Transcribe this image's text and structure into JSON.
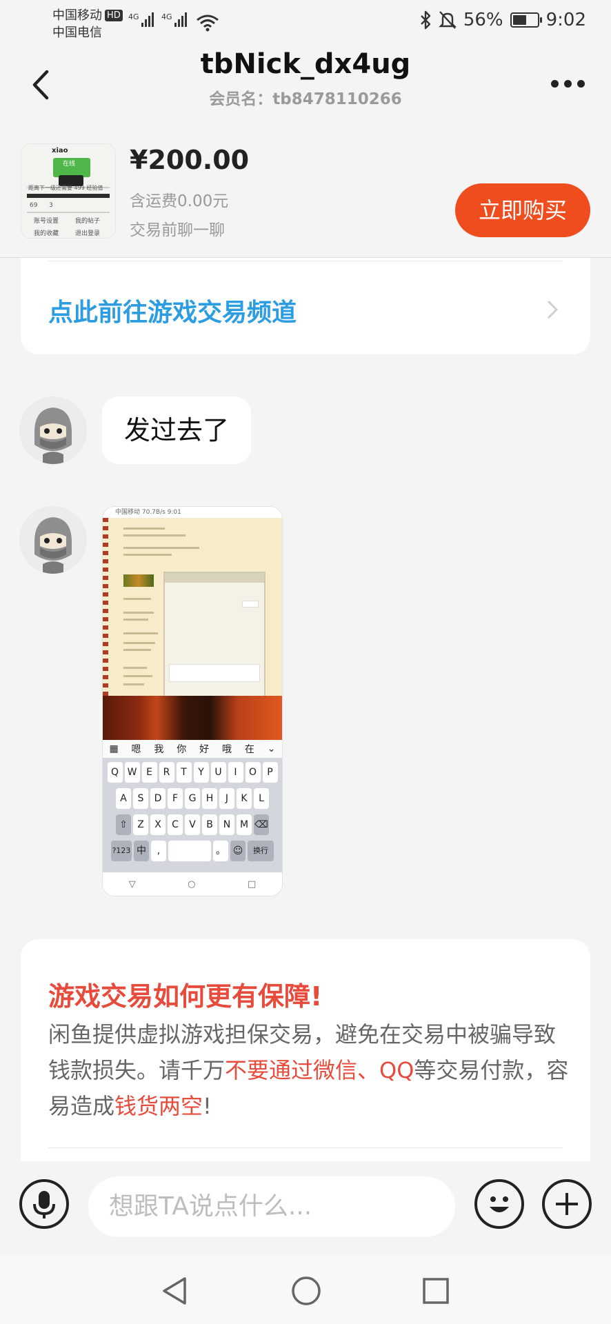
{
  "status_bar": {
    "carrier_1": "中国移动",
    "hd_badge": "HD",
    "carrier_2": "中国电信",
    "network_1": "4G",
    "network_2": "4G",
    "battery_percent": "56%",
    "battery_level": 0.56,
    "time": "9:02"
  },
  "header": {
    "title": "tbNick_dx4ug",
    "subtitle": "会员名：tb8478110266"
  },
  "product": {
    "price": "¥200.00",
    "shipping": "含运费0.00元",
    "hint": "交易前聊一聊",
    "buy_label": "立即购买",
    "thumb_texts": [
      "xiao",
      "在线",
      "距离下一级还需要 499 经验值",
      "69",
      "3",
      "账号设置",
      "我的帖子",
      "我的收藏",
      "退出登录"
    ]
  },
  "game_channel": {
    "link_text": "点此前往游戏交易频道"
  },
  "messages": [
    {
      "type": "text",
      "text": "发过去了"
    },
    {
      "type": "image"
    }
  ],
  "shot": {
    "status_text": "中国移动 70.7B/s  9:01",
    "suggestions": [
      "嗯",
      "我",
      "你",
      "好",
      "哦",
      "在"
    ],
    "row1": [
      "Q",
      "W",
      "E",
      "R",
      "T",
      "Y",
      "U",
      "I",
      "O",
      "P"
    ],
    "row2": [
      "A",
      "S",
      "D",
      "F",
      "G",
      "H",
      "J",
      "K",
      "L"
    ],
    "row3": [
      "Z",
      "X",
      "C",
      "V",
      "B",
      "N",
      "M"
    ],
    "key_symbols": "?123",
    "key_lang": "中",
    "key_enter": "换行"
  },
  "safety": {
    "title": "游戏交易如何更有保障!",
    "p1": "闲鱼提供虚拟游戏担保交易，避免在交易中被骗导致钱款损失。请千万",
    "p_red1": "不要通过微信、QQ",
    "p2": "等交易付款，容易造成",
    "p_red2": "钱货两空",
    "p3": "!"
  },
  "input_bar": {
    "placeholder": "想跟TA说点什么..."
  },
  "colors": {
    "accent_orange": "#f04d1f",
    "link_blue": "#2b9de0",
    "warning_red": "#e74b3c"
  },
  "icons": [
    "back-icon",
    "more-icon",
    "chevron-right-icon",
    "mic-icon",
    "emoji-icon",
    "add-icon",
    "nav-back-icon",
    "nav-home-icon",
    "nav-recents-icon",
    "bluetooth-icon",
    "mute-icon",
    "wifi-icon",
    "battery-icon"
  ]
}
